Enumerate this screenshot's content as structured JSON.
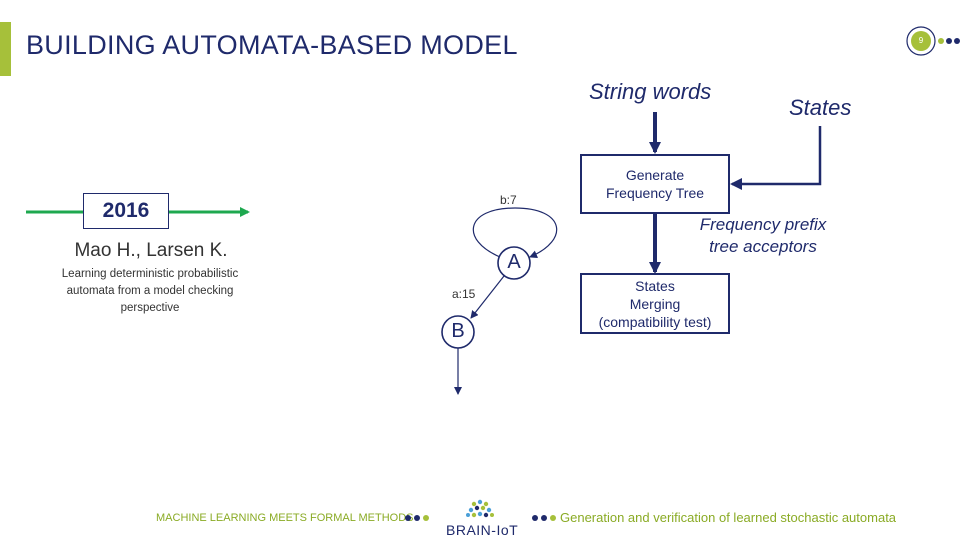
{
  "slide": {
    "title": "BUILDING AUTOMATA-BASED MODEL",
    "page_number": "9"
  },
  "timeline": {
    "year": "2016",
    "authors": "Mao H., Larsen K.",
    "paper": "Learning deterministic probabilistic automata from a model checking perspective"
  },
  "automaton": {
    "nodes": [
      "A",
      "B"
    ],
    "self_loop_label": "b:7",
    "edge_label": "a:15"
  },
  "flow": {
    "input_top": "String words",
    "input_right": "States",
    "box_generate": "Generate Frequency Tree",
    "side_note": "Frequency prefix tree acceptors",
    "box_merge_line1": "States",
    "box_merge_line2": "Merging",
    "box_merge_line3": "(compatibility test)"
  },
  "footer": {
    "left_text": "MACHINE LEARNING MEETS FORMAL METHODS",
    "logo_text": "BRAIN-IoT",
    "right_text": "Generation and verification  of learned stochastic automata"
  },
  "colors": {
    "navy": "#1f2a6b",
    "accent_green": "#a6c03a",
    "timeline_green": "#1ea84f",
    "footer_green": "#8aab25"
  }
}
